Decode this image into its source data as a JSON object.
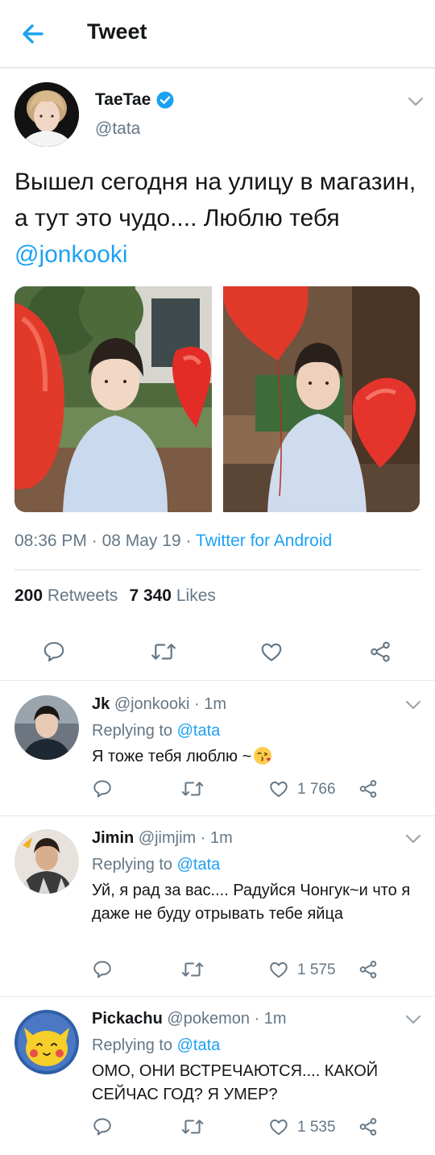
{
  "header": {
    "title": "Tweet"
  },
  "tweet": {
    "author_name": "TaeTae",
    "author_handle": "@tata",
    "text_before_mention": "Вышел сегодня на улицу в магазин, а тут это чудо.... Люблю тебя ",
    "mention": "@jonkooki",
    "time": "08:36 PM",
    "date": "08 May 19",
    "source": "Twitter for Android",
    "retweets_count": "200",
    "retweets_label": "Retweets",
    "likes_count": "7 340",
    "likes_label": "Likes"
  },
  "replies": [
    {
      "name": "Jk",
      "handle": "@jonkooki",
      "time": "1m",
      "replying_label": "Replying to",
      "replying_to": "@tata",
      "text": "Я тоже тебя люблю ~",
      "emoji": "face-blowing-kiss",
      "likes": "1 766"
    },
    {
      "name": "Jimin",
      "handle": "@jimjim",
      "time": "1m",
      "replying_label": "Replying to",
      "replying_to": "@tata",
      "text": "Уй, я рад за вас.... Радуйся Чонгук~и что я даже не буду отрывать тебе яйца",
      "likes": "1 575"
    },
    {
      "name": "Pickachu",
      "handle": "@pokemon",
      "time": "1m",
      "replying_label": "Replying to",
      "replying_to": "@tata",
      "text": "ОМО, ОНИ ВСТРЕЧАЮТСЯ.... КАКОЙ СЕЙЧАС ГОД? Я УМЕР?",
      "likes": "1 535"
    }
  ],
  "icons": {
    "back": "arrow-left-icon",
    "verified": "verified-badge-icon",
    "more": "chevron-down-icon",
    "reply": "comment-icon",
    "retweet": "retweet-icon",
    "like": "heart-icon",
    "share": "share-icon"
  },
  "colors": {
    "accent": "#1da1f2",
    "secondary_text": "#657786",
    "primary_text": "#14171a",
    "divider": "#e1e8ed"
  }
}
